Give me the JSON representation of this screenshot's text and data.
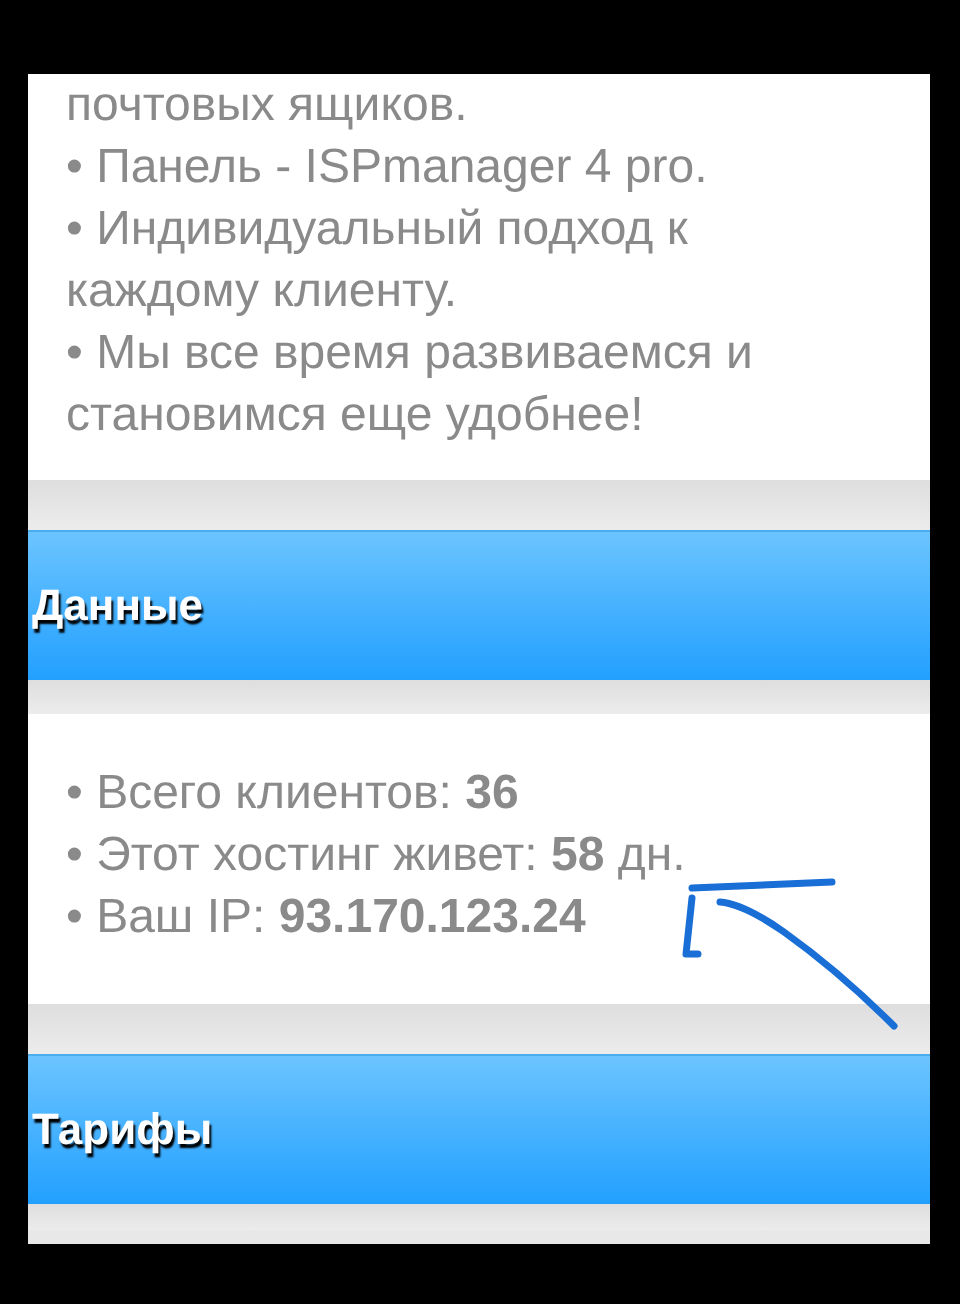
{
  "intro": {
    "paragraphs": [
      "почтовых ящиков.",
      "• Панель - ISPmanager 4 pro.",
      "• Индивидуальный подход к каждому клиенту.",
      "• Мы все время развиваемся и становимся еще удобнее!"
    ]
  },
  "sections": [
    {
      "title": "Данные",
      "items": [
        "• Всего клиентов: **36**",
        "• Этот хостинг живет: **58** дн.",
        "• Ваш IP: **93.170.123.24**"
      ]
    },
    {
      "title": "Тарифы"
    }
  ],
  "annotation": {
    "kind": "marker"
  }
}
